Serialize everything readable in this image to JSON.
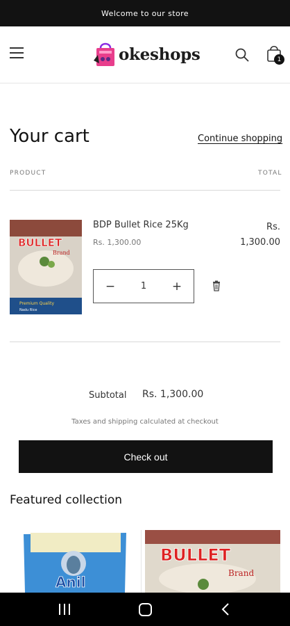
{
  "announcement": "Welcome to our store",
  "header": {
    "logo_text": "okeshops",
    "cart_count": "1"
  },
  "cart": {
    "title": "Your cart",
    "continue_label": "Continue shopping",
    "col_product": "PRODUCT",
    "col_total": "TOTAL",
    "items": [
      {
        "name": "BDP Bullet Rice 25Kg",
        "price": "Rs. 1,300.00",
        "total_line1": "Rs.",
        "total_line2": "1,300.00",
        "quantity": "1",
        "image_brand": "BULLET",
        "image_sub": "Brand",
        "image_tag1": "Premium Quality",
        "image_tag2": "Nadu Rice"
      }
    ],
    "subtotal_label": "Subtotal",
    "subtotal_value": "Rs. 1,300.00",
    "tax_note": "Taxes and shipping calculated at checkout",
    "checkout_label": "Check out"
  },
  "featured": {
    "title": "Featured collection",
    "products": [
      {
        "image_brand": "Anil"
      },
      {
        "image_brand": "BULLET",
        "image_sub": "Brand"
      }
    ]
  },
  "colors": {
    "primary": "#121212",
    "accent_pink": "#e83e8c"
  }
}
